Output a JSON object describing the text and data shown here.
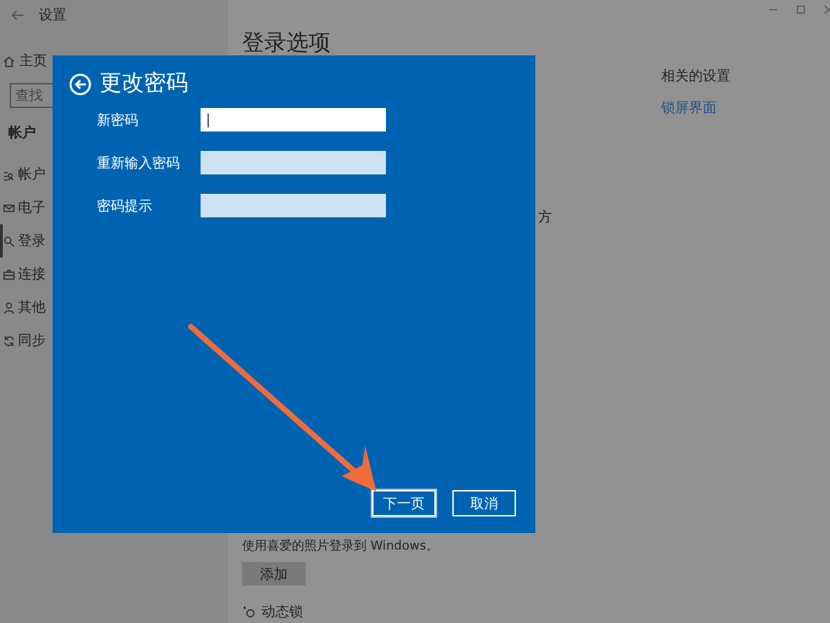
{
  "window": {
    "title": "设置"
  },
  "sidebar": {
    "home": "主页",
    "search": {
      "placeholder": "查找"
    },
    "section": "帐户",
    "items": [
      {
        "label": "帐户",
        "selected": false
      },
      {
        "label": "电子",
        "selected": false
      },
      {
        "label": "登录",
        "selected": true
      },
      {
        "label": "连接",
        "selected": false
      },
      {
        "label": "其他",
        "selected": false
      },
      {
        "label": "同步",
        "selected": false
      }
    ]
  },
  "main": {
    "title": "登录选项",
    "partial_line": "方",
    "photo_caption": "使用喜爱的照片登录到 Windows。",
    "add_button": "添加",
    "dynamic_lock": "动态锁"
  },
  "related": {
    "heading": "相关的设置",
    "links": [
      "锁屏界面"
    ]
  },
  "dialog": {
    "title": "更改密码",
    "fields": [
      {
        "label": "新密码",
        "focused": true
      },
      {
        "label": "重新输入密码",
        "focused": false
      },
      {
        "label": "密码提示",
        "focused": false
      }
    ],
    "buttons": [
      {
        "label": "下一页",
        "default": true
      },
      {
        "label": "取消",
        "default": false
      }
    ]
  }
}
